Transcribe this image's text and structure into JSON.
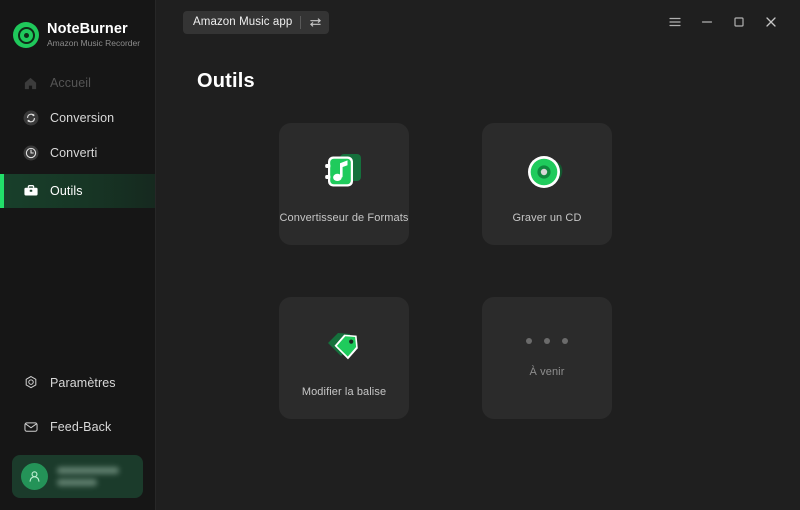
{
  "brand": {
    "name": "NoteBurner",
    "subtitle": "Amazon Music Recorder",
    "logo_icon": "noteburner-disc-logo",
    "accent_color": "#1fc85b"
  },
  "sidebar": {
    "items": [
      {
        "label": "Accueil",
        "icon": "home-icon",
        "state": "disabled"
      },
      {
        "label": "Conversion",
        "icon": "sync-icon",
        "state": "default"
      },
      {
        "label": "Converti",
        "icon": "clock-icon",
        "state": "default"
      },
      {
        "label": "Outils",
        "icon": "briefcase-icon",
        "state": "active"
      }
    ],
    "bottom_items": [
      {
        "label": "Paramètres",
        "icon": "gear-outline-icon"
      },
      {
        "label": "Feed-Back",
        "icon": "envelope-icon"
      }
    ],
    "user_card": {
      "avatar_icon": "person-icon",
      "name_masked": "",
      "plan_masked": ""
    }
  },
  "titlebar": {
    "app_selector": {
      "label": "Amazon Music app",
      "swap_icon": "swap-arrows-icon"
    },
    "window_controls": [
      {
        "name": "menu",
        "icon": "hamburger-icon"
      },
      {
        "name": "minimize",
        "icon": "minimize-icon"
      },
      {
        "name": "maximize",
        "icon": "maximize-icon"
      },
      {
        "name": "close",
        "icon": "close-icon"
      }
    ]
  },
  "main": {
    "page_title": "Outils",
    "tools": [
      {
        "label": "Convertisseur de Formats",
        "icon": "format-converter-icon",
        "enabled": true
      },
      {
        "label": "Graver un CD",
        "icon": "cd-burn-icon",
        "enabled": true
      },
      {
        "label": "Modifier la balise",
        "icon": "tag-edit-icon",
        "enabled": true
      },
      {
        "label": "À venir",
        "icon": "three-dots-icon",
        "enabled": false
      }
    ]
  },
  "colors": {
    "sidebar_bg": "#161616",
    "main_bg": "#1f1f1f",
    "card_bg": "#2b2b2b",
    "accent_green": "#22e06a",
    "icon_green": "#22c55e",
    "user_card_bg": "#1b3b2b"
  }
}
